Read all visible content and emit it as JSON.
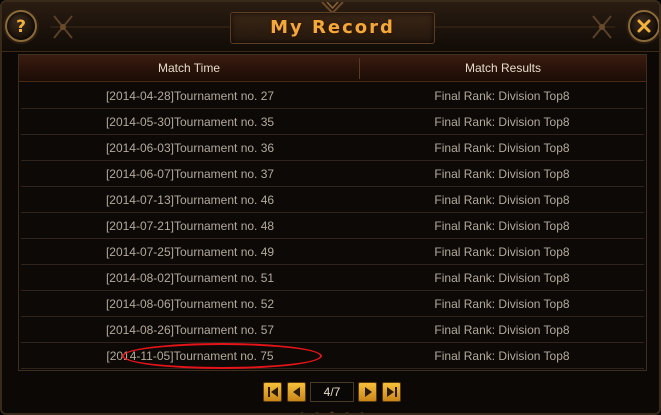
{
  "window": {
    "title": "My Record"
  },
  "table": {
    "headers": [
      "Match Time",
      "Match Results"
    ],
    "rows": [
      {
        "time": "[2014-04-28]Tournament no. 27",
        "result": "Final Rank: Division Top8"
      },
      {
        "time": "[2014-05-30]Tournament no. 35",
        "result": "Final Rank: Division Top8"
      },
      {
        "time": "[2014-06-03]Tournament no. 36",
        "result": "Final Rank: Division Top8"
      },
      {
        "time": "[2014-06-07]Tournament no. 37",
        "result": "Final Rank: Division Top8"
      },
      {
        "time": "[2014-07-13]Tournament no. 46",
        "result": "Final Rank: Division Top8"
      },
      {
        "time": "[2014-07-21]Tournament no. 48",
        "result": "Final Rank: Division Top8"
      },
      {
        "time": "[2014-07-25]Tournament no. 49",
        "result": "Final Rank: Division Top8"
      },
      {
        "time": "[2014-08-02]Tournament no. 51",
        "result": "Final Rank: Division Top8"
      },
      {
        "time": "[2014-08-06]Tournament no. 52",
        "result": "Final Rank: Division Top8"
      },
      {
        "time": "[2014-08-26]Tournament no. 57",
        "result": "Final Rank: Division Top8"
      },
      {
        "time": "[2014-11-05]Tournament no. 75",
        "result": "Final Rank: Division Top8"
      }
    ]
  },
  "pagination": {
    "page_label": "4/7"
  },
  "icons": {
    "help": "question-mark-icon",
    "close": "close-icon",
    "first": "first-page-icon",
    "prev": "prev-page-icon",
    "next": "next-page-icon",
    "last": "last-page-icon"
  },
  "colors": {
    "title": "#f2a83a",
    "highlight": "#e4141a",
    "pager_button": "#e3a22a"
  }
}
